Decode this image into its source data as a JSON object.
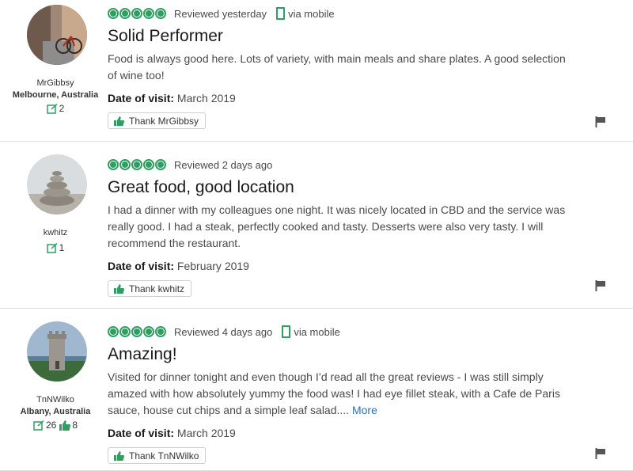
{
  "colors": {
    "rating_green": "#2f9e60",
    "link_blue": "#2c6fb3"
  },
  "icons": {
    "edit": "edit-icon",
    "thumb": "thumbs-up-icon",
    "phone": "mobile-phone-icon",
    "flag": "flag-icon"
  },
  "reviews": [
    {
      "user": "MrGibbsy",
      "location": "Melbourne, Australia",
      "contributions": "2",
      "helpful": "",
      "rating": 5,
      "date": "Reviewed yesterday",
      "via": "via mobile",
      "title": "Solid Performer",
      "body": "Food is always good here. Lots of variety, with main meals and share plates. A good selection of wine too!",
      "more": "",
      "visit_label": "Date of visit:",
      "visit_value": "March 2019",
      "thank": "Thank MrGibbsy"
    },
    {
      "user": "kwhitz",
      "location": "",
      "contributions": "1",
      "helpful": "",
      "rating": 5,
      "date": "Reviewed 2 days ago",
      "via": "",
      "title": "Great food, good location",
      "body": "I had a dinner with my colleagues one night. It was nicely located in CBD and the service was really good. I had a steak, perfectly cooked and tasty. Desserts were also very tasty. I will recommend the restaurant.",
      "more": "",
      "visit_label": "Date of visit:",
      "visit_value": "February 2019",
      "thank": "Thank kwhitz"
    },
    {
      "user": "TnNWilko",
      "location": "Albany, Australia",
      "contributions": "26",
      "helpful": "8",
      "rating": 5,
      "date": "Reviewed 4 days ago",
      "via": "via mobile",
      "title": "Amazing!",
      "body": "Visited for dinner tonight and even though I’d read all the great reviews - I was still simply amazed with how absolutely yummy the food was! I had eye fillet steak, with a Cafe de Paris sauce, house cut chips and a simple leaf salad....",
      "more": "More",
      "visit_label": "Date of visit:",
      "visit_value": "March 2019",
      "thank": "Thank TnNWilko"
    }
  ]
}
